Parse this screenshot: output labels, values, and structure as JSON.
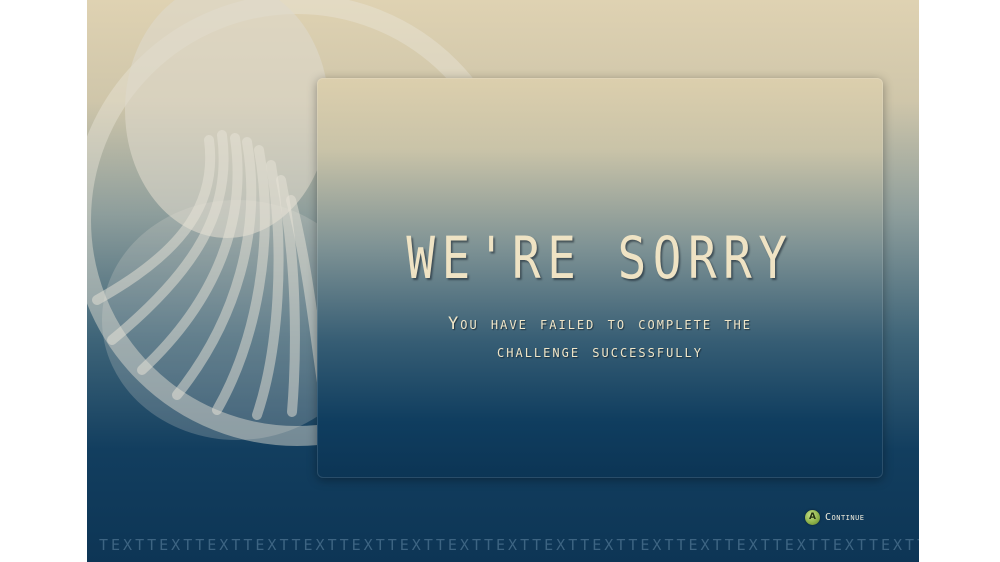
{
  "dialog": {
    "title": "WE'RE SORRY",
    "message_line1": "You have failed to complete the",
    "message_line2": "challenge successfully"
  },
  "footer": {
    "continue_button_glyph": "A",
    "continue_label": "Continue",
    "ticker_text": "TEXTTEXTTEXTTEXTTEXTTEXTTEXTTEXTTEXTTEXTTEXTTEXTTEXTTEXTTEXTTEXTTEXTTEXTTEXTTEXTTEXTTEX"
  },
  "colors": {
    "accent_text": "#efe3c4",
    "button_green": "#8eb24a",
    "ticker": "#3d6482"
  }
}
